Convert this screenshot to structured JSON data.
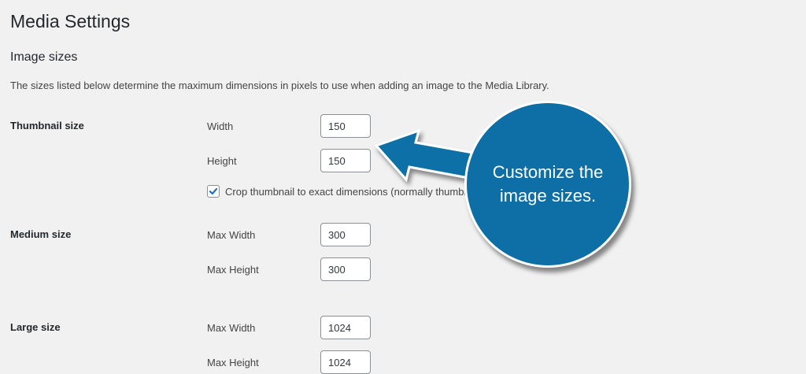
{
  "page": {
    "title": "Media Settings"
  },
  "image_sizes": {
    "title": "Image sizes",
    "description": "The sizes listed below determine the maximum dimensions in pixels to use when adding an image to the Media Library."
  },
  "thumbnail": {
    "label": "Thumbnail size",
    "width_label": "Width",
    "width_value": "150",
    "height_label": "Height",
    "height_value": "150",
    "crop_label": "Crop thumbnail to exact dimensions (normally thumbnails are proportional)",
    "crop_checked": true
  },
  "medium": {
    "label": "Medium size",
    "width_label": "Max Width",
    "width_value": "300",
    "height_label": "Max Height",
    "height_value": "300"
  },
  "large": {
    "label": "Large size",
    "width_label": "Max Width",
    "width_value": "1024",
    "height_label": "Max Height",
    "height_value": "1024"
  },
  "callout": {
    "text": "Customize the image sizes.",
    "color": "#0e6fa6"
  },
  "icons": {
    "checkbox": "checkmark-icon",
    "arrow": "arrow-left-icon"
  }
}
